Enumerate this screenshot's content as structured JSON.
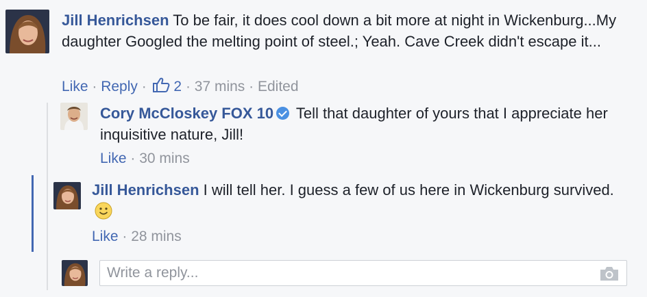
{
  "comments": [
    {
      "author": "Jill Henrichsen",
      "text": "To be fair, it does cool down a bit more at night in Wickenburg...My daughter Googled the melting point of steel.; Yeah. Cave Creek didn't escape it...",
      "like_label": "Like",
      "reply_label": "Reply",
      "reaction_count": "2",
      "time": "37 mins",
      "edited_label": "Edited"
    }
  ],
  "replies": [
    {
      "author": "Cory McCloskey FOX 10",
      "verified": true,
      "text": "Tell that daughter of yours that I appreciate her inquisitive nature, Jill!",
      "like_label": "Like",
      "time": "30 mins"
    },
    {
      "author": "Jill Henrichsen",
      "text": "I will tell her. I guess a few of us here in Wickenburg survived.",
      "emoji": "smiley-emoji",
      "like_label": "Like",
      "time": "28 mins"
    }
  ],
  "composer": {
    "placeholder": "Write a reply...",
    "camera_icon": "camera-icon"
  },
  "colors": {
    "name": "#365899",
    "link": "#4267b2",
    "meta": "#90949c",
    "background": "#f6f7f9",
    "thread_highlight": "#4267b2"
  }
}
